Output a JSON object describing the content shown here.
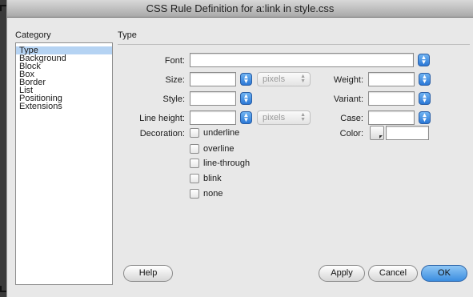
{
  "window": {
    "title": "CSS Rule Definition for a:link in style.css"
  },
  "category": {
    "label": "Category",
    "items": [
      "Type",
      "Background",
      "Block",
      "Box",
      "Border",
      "List",
      "Positioning",
      "Extensions"
    ],
    "selected": "Type"
  },
  "section": {
    "title": "Type"
  },
  "fields": {
    "font": {
      "label": "Font:",
      "value": ""
    },
    "size": {
      "label": "Size:",
      "value": "",
      "units": "pixels"
    },
    "style": {
      "label": "Style:",
      "value": ""
    },
    "line_height": {
      "label": "Line height:",
      "value": "",
      "units": "pixels"
    },
    "weight": {
      "label": "Weight:",
      "value": ""
    },
    "variant": {
      "label": "Variant:",
      "value": ""
    },
    "case": {
      "label": "Case:",
      "value": ""
    },
    "color": {
      "label": "Color:",
      "value": ""
    }
  },
  "decoration": {
    "label": "Decoration:",
    "options": [
      "underline",
      "overline",
      "line-through",
      "blink",
      "none"
    ]
  },
  "buttons": {
    "help": "Help",
    "apply": "Apply",
    "cancel": "Cancel",
    "ok": "OK"
  },
  "colors": {
    "selection": "#b5d3f3",
    "accent": "#3c8de0"
  }
}
